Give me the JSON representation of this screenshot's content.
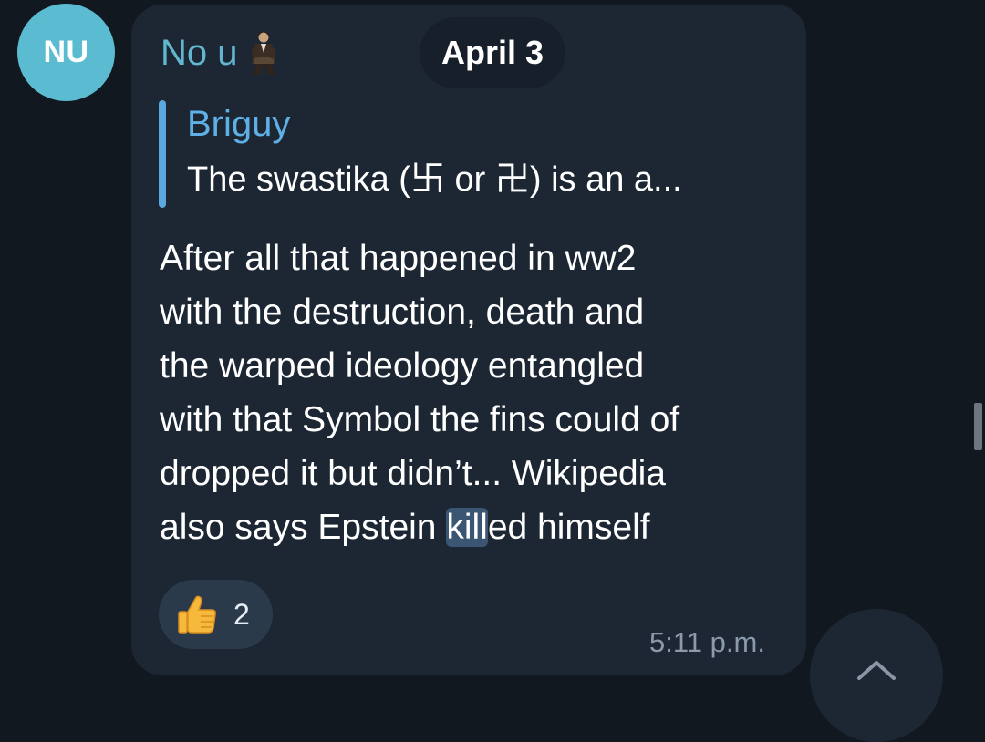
{
  "avatar": {
    "initials": "NU",
    "color": "#5bbcd1"
  },
  "message": {
    "sender": "No u",
    "sender_color": "#62b7d0",
    "sender_badge_icon": "figure-sticker-icon",
    "date_separator": "April 3",
    "reply": {
      "author": "Briguy",
      "text": "The swastika (卐 or 卍) is an a..."
    },
    "body_lines": [
      "After all that happened in ww2",
      "with the destruction, death and",
      "the warped ideology entangled",
      "with that Symbol the fins could of",
      "dropped it but didn’t... Wikipedia"
    ],
    "last_line": {
      "before": "also says Epstein ",
      "highlight": "kill",
      "after": "ed himself"
    },
    "reaction": {
      "icon": "thumbs-up-icon",
      "count": "2"
    },
    "timestamp": "5:11 p.m."
  },
  "scroll_down_button": {
    "icon": "chevron-up-icon"
  }
}
